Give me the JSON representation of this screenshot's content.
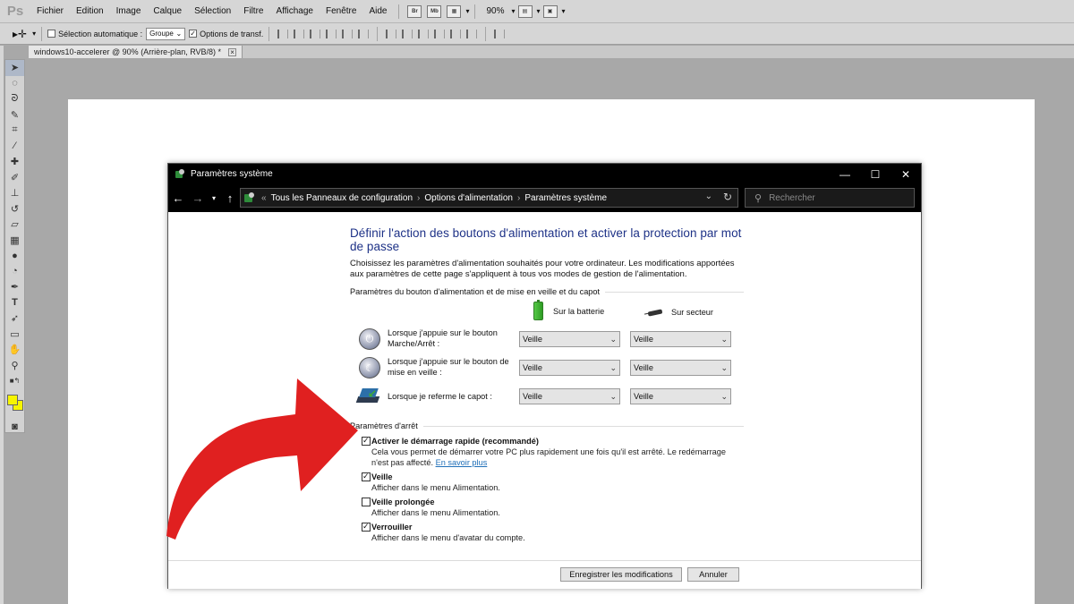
{
  "photoshop": {
    "logo": "Ps",
    "menu": [
      "Fichier",
      "Edition",
      "Image",
      "Calque",
      "Sélection",
      "Filtre",
      "Affichage",
      "Fenêtre",
      "Aide"
    ],
    "mini_buttons": [
      "Br",
      "Mb"
    ],
    "zoom": "90%",
    "options_bar": {
      "auto_select_label": "Sélection automatique :",
      "auto_select_value": "Groupe",
      "transform_label": "Options de transf."
    },
    "document_tab": "windows10-accelerer @ 90% (Arrière-plan, RVB/8) *",
    "colors": {
      "foreground": "#f7f500",
      "background": "#f7f500"
    }
  },
  "dialog": {
    "title": "Paramètres système",
    "breadcrumb": {
      "prefix": "«",
      "items": [
        "Tous les Panneaux de configuration",
        "Options d'alimentation",
        "Paramètres système"
      ]
    },
    "search_placeholder": "Rechercher",
    "heading": "Définir l'action des boutons d'alimentation et activer la protection par mot de passe",
    "description": "Choisissez les paramètres d'alimentation souhaités pour votre ordinateur. Les modifications apportées aux paramètres de cette page s'appliquent à tous vos modes de gestion de l'alimentation.",
    "power_group_title": "Paramètres du bouton d'alimentation et de mise en veille et du capot",
    "col_battery": "Sur la batterie",
    "col_plugged": "Sur secteur",
    "rows": [
      {
        "label": "Lorsque j'appuie sur le bouton Marche/Arrêt :",
        "battery": "Veille",
        "plugged": "Veille"
      },
      {
        "label": "Lorsque j'appuie sur le bouton de mise en veille :",
        "battery": "Veille",
        "plugged": "Veille"
      },
      {
        "label": "Lorsque je referme le capot :",
        "battery": "Veille",
        "plugged": "Veille"
      }
    ],
    "shutdown_group_title": "Paramètres d'arrêt",
    "options": [
      {
        "title": "Activer le démarrage rapide (recommandé)",
        "desc": "Cela vous permet de démarrer votre PC plus rapidement une fois qu'il est arrêté. Le redémarrage n'est pas affecté.",
        "link": "En savoir plus",
        "checked": true
      },
      {
        "title": "Veille",
        "desc": "Afficher dans le menu Alimentation.",
        "checked": true
      },
      {
        "title": "Veille prolongée",
        "desc": "Afficher dans le menu Alimentation.",
        "checked": false
      },
      {
        "title": "Verrouiller",
        "desc": "Afficher dans le menu d'avatar du compte.",
        "checked": true
      }
    ],
    "buttons": {
      "save": "Enregistrer les modifications",
      "cancel": "Annuler"
    }
  },
  "overlay": {
    "arrow_color": "#e02020"
  }
}
